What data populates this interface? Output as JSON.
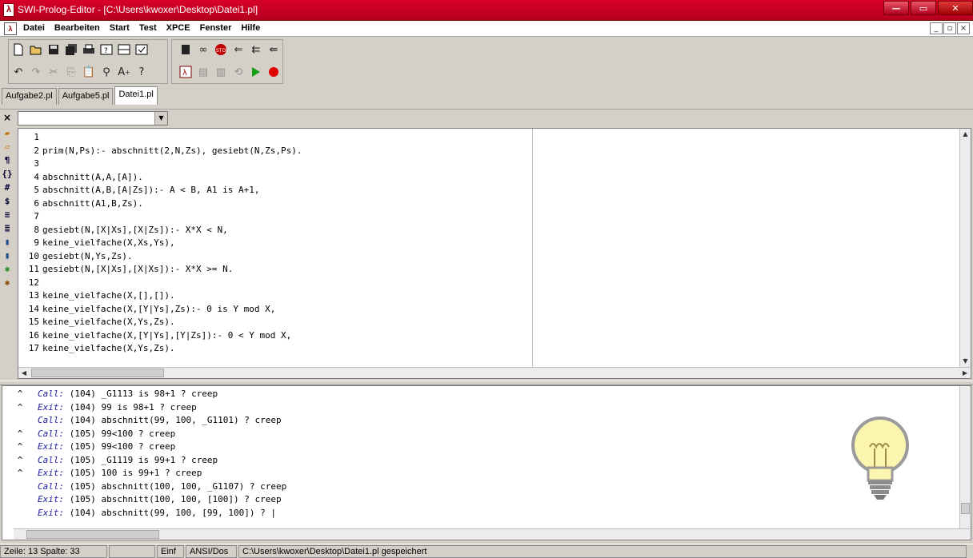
{
  "window": {
    "title": "SWI-Prolog-Editor - [C:\\Users\\kwoxer\\Desktop\\Datei1.pl]",
    "minimize": "—",
    "maximize": "▭",
    "close": "✕"
  },
  "menu": {
    "items": [
      "Datei",
      "Bearbeiten",
      "Start",
      "Test",
      "XPCE",
      "Fenster",
      "Hilfe"
    ],
    "mdi_buttons": [
      "_",
      "▫",
      "×"
    ]
  },
  "tabs": [
    "Aufgabe2.pl",
    "Aufgabe5.pl",
    "Datei1.pl"
  ],
  "active_tab": 2,
  "combo": {
    "close": "×",
    "value": "",
    "arrow": "▼"
  },
  "editor": {
    "lines": [
      {
        "n": "1",
        "t": ""
      },
      {
        "n": "2",
        "t": "prim(N,Ps):- abschnitt(2,N,Zs), gesiebt(N,Zs,Ps)."
      },
      {
        "n": "3",
        "t": ""
      },
      {
        "n": "4",
        "t": "abschnitt(A,A,[A])."
      },
      {
        "n": "5",
        "t": "abschnitt(A,B,[A|Zs]):- A < B, A1 is A+1,"
      },
      {
        "n": "6",
        "t": "abschnitt(A1,B,Zs)."
      },
      {
        "n": "7",
        "t": ""
      },
      {
        "n": "8",
        "t": "gesiebt(N,[X|Xs],[X|Zs]):- X*X < N,"
      },
      {
        "n": "9",
        "t": "keine_vielfache(X,Xs,Ys),"
      },
      {
        "n": "10",
        "t": "gesiebt(N,Ys,Zs)."
      },
      {
        "n": "11",
        "t": "gesiebt(N,[X|Xs],[X|Xs]):- X*X >= N."
      },
      {
        "n": "12",
        "t": ""
      },
      {
        "n": "13",
        "t": "keine_vielfache(X,[],[])."
      },
      {
        "n": "14",
        "t": "keine_vielfache(X,[Y|Ys],Zs):- 0 is Y mod X,"
      },
      {
        "n": "15",
        "t": "keine_vielfache(X,Ys,Zs)."
      },
      {
        "n": "16",
        "t": "keine_vielfache(X,[Y|Ys],[Y|Zs]):- 0 < Y mod X,"
      },
      {
        "n": "17",
        "t": "keine_vielfache(X,Ys,Zs)."
      }
    ]
  },
  "console": {
    "lines": [
      {
        "caret": "^",
        "port": "Call:",
        "t": " (104) _G1113 is 98+1 ? creep"
      },
      {
        "caret": "^",
        "port": "Exit:",
        "t": " (104) 99 is 98+1 ? creep"
      },
      {
        "caret": "",
        "port": "Call:",
        "t": " (104) abschnitt(99, 100, _G1101) ? creep"
      },
      {
        "caret": "^",
        "port": "Call:",
        "t": " (105) 99<100 ? creep"
      },
      {
        "caret": "^",
        "port": "Exit:",
        "t": " (105) 99<100 ? creep"
      },
      {
        "caret": "^",
        "port": "Call:",
        "t": " (105) _G1119 is 99+1 ? creep"
      },
      {
        "caret": "^",
        "port": "Exit:",
        "t": " (105) 100 is 99+1 ? creep"
      },
      {
        "caret": "",
        "port": "Call:",
        "t": " (105) abschnitt(100, 100, _G1107) ? creep"
      },
      {
        "caret": "",
        "port": "Exit:",
        "t": " (105) abschnitt(100, 100, [100]) ? creep"
      },
      {
        "caret": "",
        "port": "Exit:",
        "t": " (104) abschnitt(99, 100, [99, 100]) ? |"
      }
    ]
  },
  "status": {
    "position": "Zeile: 13  Spalte: 33",
    "empty": "",
    "mode": "Einf",
    "encoding": "ANSI/Dos",
    "message": "C:\\Users\\kwoxer\\Desktop\\Datei1.pl gespeichert"
  },
  "colors": {
    "titlebar": "#c8001f",
    "port": "#1e1ea0",
    "bulb": "#fbf5b0"
  }
}
